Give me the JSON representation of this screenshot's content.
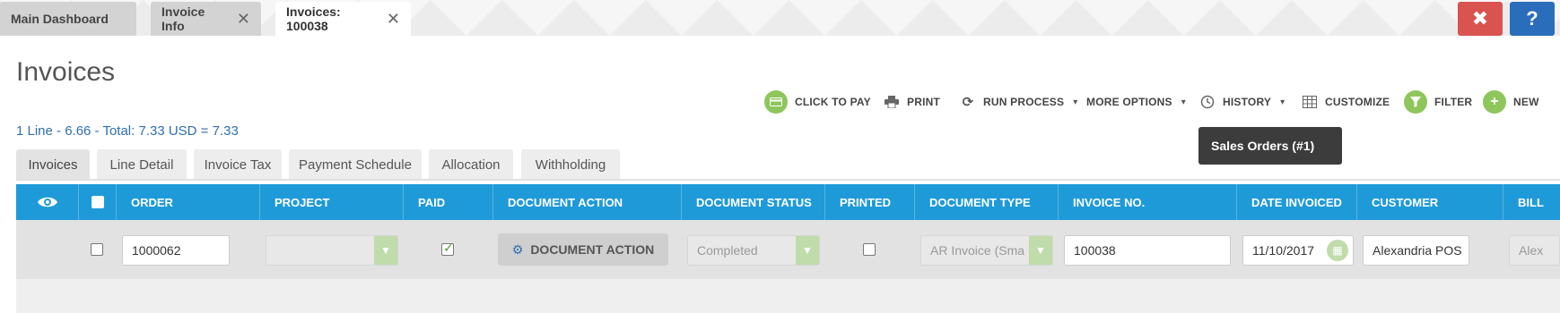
{
  "tabs": [
    {
      "label": "Main Dashboard",
      "closable": false
    },
    {
      "label": "Invoice Info",
      "closable": true
    },
    {
      "label": "Invoices: 100038",
      "closable": true,
      "active": true
    }
  ],
  "window_buttons": {
    "close": "✖",
    "help": "?"
  },
  "page": {
    "title": "Invoices",
    "summary": "1 Line - 6.66 - Total: 7.33 USD = 7.33"
  },
  "toolbar": {
    "click_to_pay": "CLICK TO PAY",
    "print": "PRINT",
    "run_process": "RUN PROCESS",
    "more_options": "MORE OPTIONS",
    "history": "HISTORY",
    "customize": "CUSTOMIZE",
    "filter": "FILTER",
    "new": "NEW"
  },
  "tooltip": "Sales Orders (#1)",
  "subtabs": [
    "Invoices",
    "Line Detail",
    "Invoice Tax",
    "Payment Schedule",
    "Allocation",
    "Withholding"
  ],
  "grid": {
    "columns": [
      "ORDER",
      "PROJECT",
      "PAID",
      "DOCUMENT ACTION",
      "DOCUMENT STATUS",
      "PRINTED",
      "DOCUMENT TYPE",
      "INVOICE NO.",
      "DATE INVOICED",
      "CUSTOMER",
      "BILL"
    ],
    "row": {
      "order": "1000062",
      "project": "",
      "paid": true,
      "document_action": "DOCUMENT ACTION",
      "document_status": "Completed",
      "printed": false,
      "document_type": "AR Invoice (Sma",
      "invoice_no": "100038",
      "date_invoiced": "11/10/2017",
      "customer": "Alexandria POS",
      "bill": "Alex"
    }
  },
  "colors": {
    "accent": "#1f9ad9",
    "green": "#8ec65c",
    "link": "#2f6fae",
    "danger": "#d9534f",
    "help": "#2a6ebb"
  }
}
